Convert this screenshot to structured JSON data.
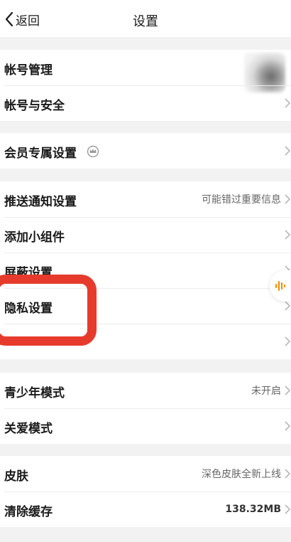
{
  "nav": {
    "back_label": "返回",
    "title": "设置"
  },
  "groups": [
    {
      "rows": [
        {
          "label": "帐号管理"
        },
        {
          "label": "帐号与安全"
        }
      ]
    },
    {
      "rows": [
        {
          "label": "会员专属设置"
        }
      ]
    },
    {
      "rows": [
        {
          "label": "推送通知设置",
          "value": "可能错过重要信息"
        },
        {
          "label": "添加小组件"
        },
        {
          "label": "屏蔽设置"
        },
        {
          "label": "隐私设置"
        },
        {
          "label": ""
        }
      ]
    },
    {
      "rows": [
        {
          "label": "青少年模式",
          "value": "未开启"
        },
        {
          "label": "关爱模式"
        }
      ]
    },
    {
      "rows": [
        {
          "label": "皮肤",
          "value": "深色皮肤全新上线"
        },
        {
          "label": "清除缓存",
          "value": "138.32MB"
        }
      ]
    }
  ],
  "icons": {
    "back": "chevron-left-icon",
    "chevron": "chevron-right-icon",
    "crown": "crown-icon",
    "voice": "voice-wave-icon"
  },
  "colors": {
    "highlight": "#e63b2c",
    "accent": "#f08c00"
  }
}
